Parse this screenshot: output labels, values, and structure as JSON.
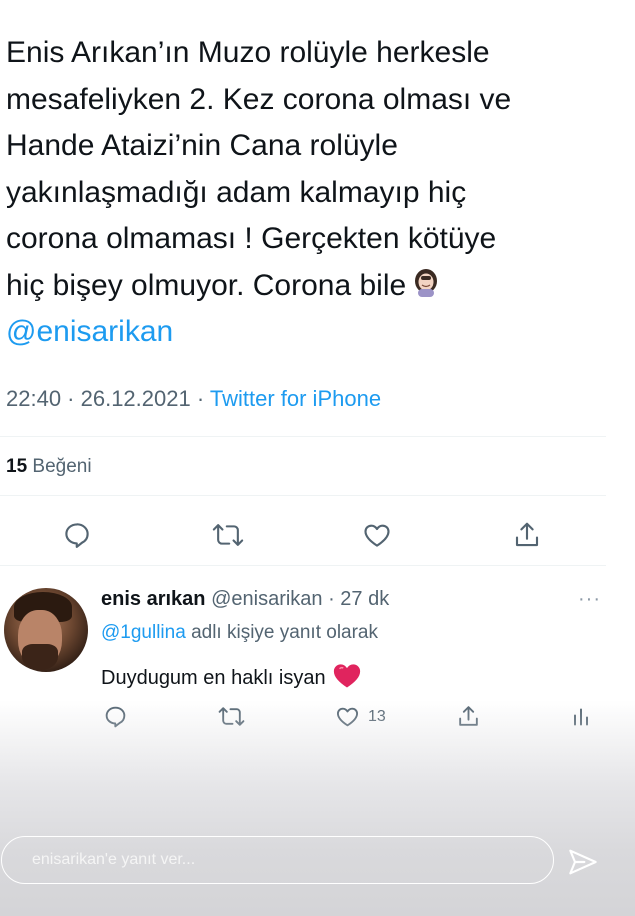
{
  "tweet": {
    "lines": [
      "Enis Arıkan’ın Muzo rolüyle herkesle",
      "mesafeliyken 2. Kez corona olması ve",
      "Hande Ataizi’nin Cana rolüyle",
      "yakınlaşmadığı adam kalmayıp hiç",
      "corona olmaması ! Gerçekten kötüye",
      "hiç bişey olmuyor. Corona bile"
    ],
    "mention": "@enisarikan",
    "time": "22:40 · 26.12.2021 · ",
    "source": "Twitter for iPhone",
    "likes_count": "15",
    "likes_label": " Beğeni"
  },
  "reply": {
    "display_name": "enis arıkan",
    "handle_time": " @enisarikan · 27 dk",
    "more": "···",
    "reply_to_mention": "@1gullina",
    "reply_to_suffix": " adlı kişiye yanıt olarak",
    "text": "Duydugum en haklı isyan",
    "like_count": "13"
  },
  "composer": {
    "placeholder": "enisarikan'e yanıt ver..."
  },
  "colors": {
    "accent": "#1d9bf0",
    "muted": "#536471",
    "heart": "#e0245e"
  },
  "icons": [
    "reply-icon",
    "retweet-icon",
    "like-icon",
    "share-icon",
    "analytics-icon",
    "send-icon"
  ]
}
